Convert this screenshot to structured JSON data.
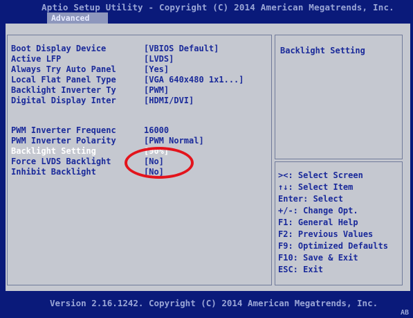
{
  "header": {
    "title": "Aptio Setup Utility - Copyright (C) 2014 American Megatrends, Inc.",
    "active_tab": "Advanced"
  },
  "settings": [
    {
      "label": "Boot Display Device",
      "value": "[VBIOS Default]"
    },
    {
      "label": "Active LFP",
      "value": "[LVDS]"
    },
    {
      "label": "Always Try Auto Panel",
      "value": "[Yes]"
    },
    {
      "label": "Local Flat Panel Type",
      "value": "[VGA   640x480   1x1...]"
    },
    {
      "label": "Backlight Inverter Ty",
      "value": "[PWM]"
    },
    {
      "label": "Digital Display Inter",
      "value": "[HDMI/DVI]"
    },
    {
      "label": "PWM Inverter Frequenc",
      "value": "16000"
    },
    {
      "label": "PWM Inverter Polarity",
      "value": "[PWM Normal]"
    },
    {
      "label": "Backlight Setting",
      "value": "[90%]",
      "selected": true
    },
    {
      "label": "Force LVDS Backlight",
      "value": "[No]"
    },
    {
      "label": "Inhibit Backlight",
      "value": "[No]"
    }
  ],
  "help": {
    "title": "Backlight Setting"
  },
  "hotkeys": [
    "><: Select Screen",
    "↑↓: Select Item",
    "Enter: Select",
    "+/-: Change Opt.",
    "F1: General Help",
    "F2: Previous Values",
    "F9: Optimized Defaults",
    "F10: Save & Exit",
    "ESC: Exit"
  ],
  "footer": {
    "version": "Version 2.16.1242. Copyright (C) 2014 American Megatrends, Inc.",
    "corner_code": "AB"
  },
  "annotation": {
    "color": "#e3141c"
  }
}
